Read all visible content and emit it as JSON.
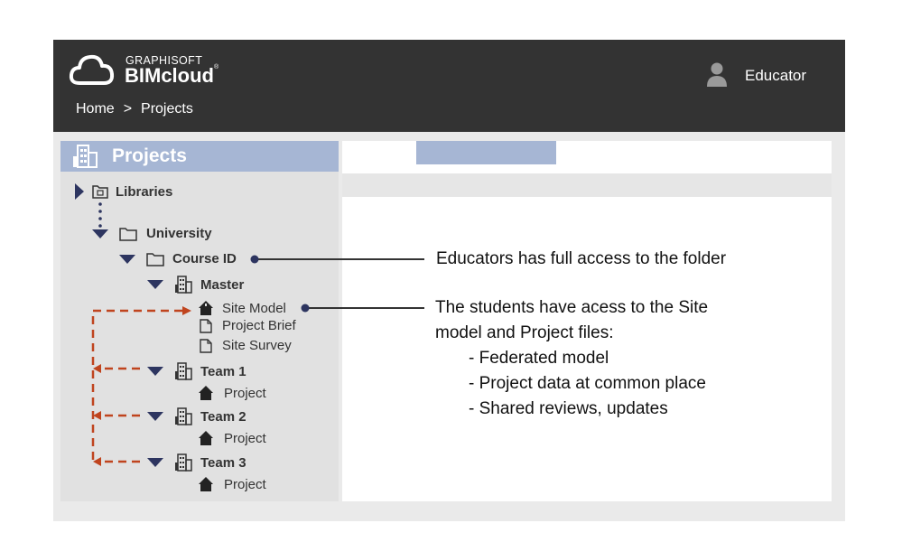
{
  "header": {
    "brand_small": "GRAPHISOFT",
    "brand_big": "BIMcloud",
    "brand_mark": "®",
    "user_name": "Educator",
    "breadcrumb": [
      "Home",
      ">",
      "Projects"
    ]
  },
  "sidebar": {
    "title": "Projects",
    "tree": {
      "libraries": "Libraries",
      "university": "University",
      "course_id": "Course ID",
      "master": "Master",
      "site_model": "Site Model",
      "project_brief": "Project Brief",
      "site_survey": "Site Survey",
      "team1": "Team 1",
      "team1_project": "Project",
      "team2": "Team 2",
      "team2_project": "Project",
      "team3": "Team 3",
      "team3_project": "Project"
    }
  },
  "annotations": {
    "educator_note": "Educators has full access to the folder",
    "student_note_line1": "The students have acess to the Site",
    "student_note_line2": "model and Project files:",
    "bullets": [
      "- Federated model",
      "- Project data at common place",
      "- Shared reviews, updates"
    ]
  },
  "colors": {
    "header_bg": "#333333",
    "accent": "#a6b6d4",
    "tree_arrow": "#2d3560",
    "dash_arrow": "#c0441e"
  }
}
